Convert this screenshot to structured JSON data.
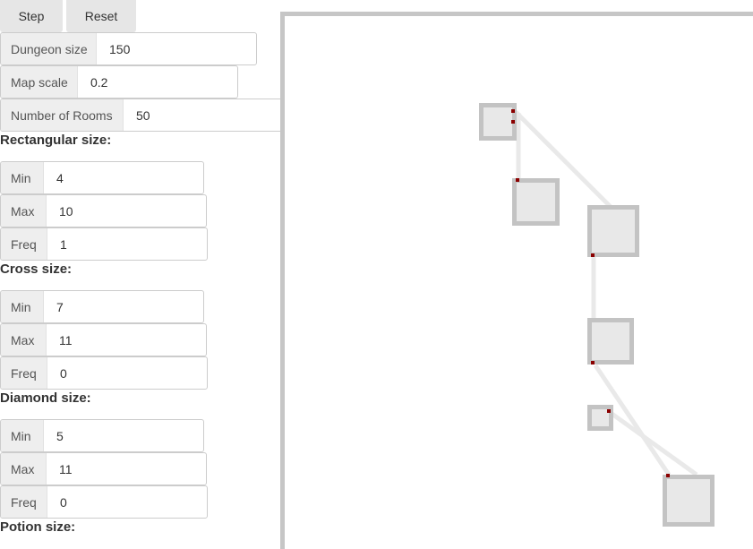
{
  "toolbar": {
    "step_label": "Step",
    "reset_label": "Reset"
  },
  "settings": {
    "dungeon_size": {
      "label": "Dungeon size",
      "value": "150"
    },
    "map_scale": {
      "label": "Map scale",
      "value": "0.2"
    },
    "number_of_rooms": {
      "label": "Number of Rooms",
      "value": "50"
    }
  },
  "rectangular": {
    "heading": "Rectangular size:",
    "min": {
      "label": "Min",
      "value": "4"
    },
    "max": {
      "label": "Max",
      "value": "10"
    },
    "freq": {
      "label": "Freq",
      "value": "1"
    }
  },
  "cross": {
    "heading": "Cross size:",
    "min": {
      "label": "Min",
      "value": "7"
    },
    "max": {
      "label": "Max",
      "value": "11"
    },
    "freq": {
      "label": "Freq",
      "value": "0"
    }
  },
  "diamond": {
    "heading": "Diamond size:",
    "min": {
      "label": "Min",
      "value": "5"
    },
    "max": {
      "label": "Max",
      "value": "11"
    },
    "freq": {
      "label": "Freq",
      "value": "0"
    }
  },
  "potion": {
    "heading": "Potion size:"
  },
  "colors": {
    "wall": "#c3c3c3",
    "floor": "#e8e8e8",
    "corridor": "#e9e9e9",
    "door": "#8b0000",
    "frame": "#c6c6c6"
  }
}
